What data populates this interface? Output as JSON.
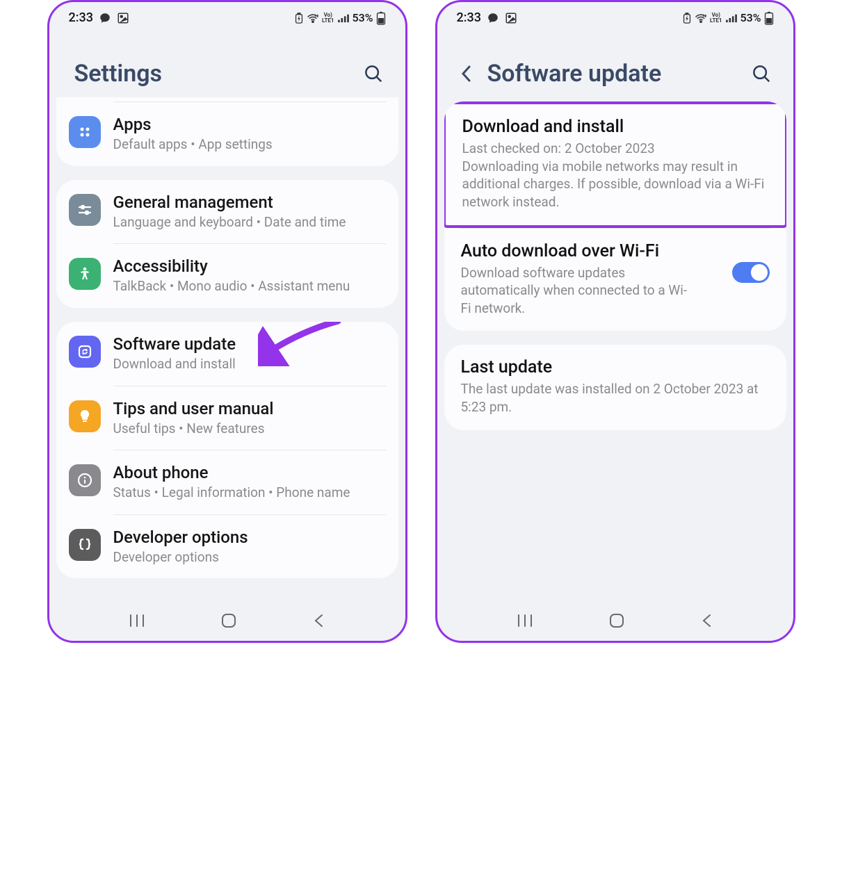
{
  "status": {
    "time": "2:33",
    "battery_pct": "53%"
  },
  "left": {
    "title": "Settings",
    "groups": [
      {
        "items": [
          {
            "label": "Apps",
            "sub": "Default apps  •  App settings",
            "icon_bg": "bg-blue",
            "icon": "apps"
          }
        ]
      },
      {
        "items": [
          {
            "label": "General management",
            "sub": "Language and keyboard  •  Date and time",
            "icon_bg": "bg-slate",
            "icon": "sliders"
          },
          {
            "label": "Accessibility",
            "sub": "TalkBack  •  Mono audio  •  Assistant menu",
            "icon_bg": "bg-green",
            "icon": "person"
          }
        ]
      },
      {
        "items": [
          {
            "label": "Software update",
            "sub": "Download and install",
            "icon_bg": "bg-purple",
            "icon": "refresh",
            "pointed": true
          },
          {
            "label": "Tips and user manual",
            "sub": "Useful tips  •  New features",
            "icon_bg": "bg-orange",
            "icon": "bulb"
          },
          {
            "label": "About phone",
            "sub": "Status  •  Legal information  •  Phone name",
            "icon_bg": "bg-gray",
            "icon": "info"
          },
          {
            "label": "Developer options",
            "sub": "Developer options",
            "icon_bg": "bg-dark",
            "icon": "braces"
          }
        ]
      }
    ]
  },
  "right": {
    "title": "Software update",
    "cards": [
      {
        "items": [
          {
            "label": "Download and install",
            "sub": "Last checked on: 2 October 2023\nDownloading via mobile networks may result in additional charges. If possible, download via a Wi-Fi network instead.",
            "highlight": true
          },
          {
            "label": "Auto download over Wi-Fi",
            "sub": "Download software updates automatically when connected to a Wi-Fi network.",
            "toggle": true
          }
        ]
      },
      {
        "items": [
          {
            "label": "Last update",
            "sub": "The last update was installed on 2 October 2023 at 5:23 pm."
          }
        ]
      }
    ]
  }
}
